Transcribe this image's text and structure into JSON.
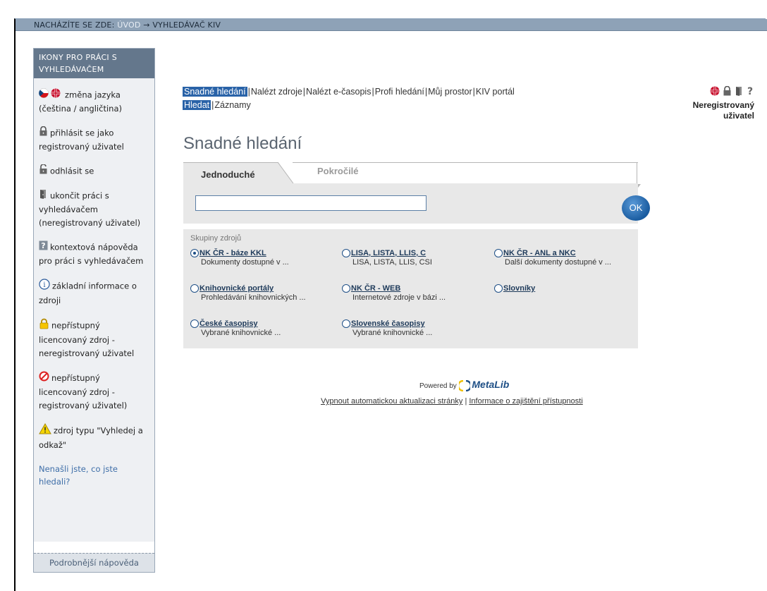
{
  "breadcrumb": {
    "prefix": "NACHÁZÍTE SE ZDE:",
    "home": "ÚVOD",
    "arrow": "→",
    "current": "VYHLEDÁVAČ KIV"
  },
  "sidebar": {
    "title": "IKONY PRO PRÁCI S VYHLEDÁVAČEM",
    "items": [
      {
        "icon": "language-flags-icon",
        "text": "změna jazyka (čeština / angličtina)"
      },
      {
        "icon": "lock-login-icon",
        "text": "přihlásit se jako registrovaný uživatel"
      },
      {
        "icon": "unlock-logout-icon",
        "text": "odhlásit se"
      },
      {
        "icon": "exit-door-icon",
        "text": "ukončit práci s vyhledávačem (neregistrovaný uživatel)"
      },
      {
        "icon": "help-question-icon",
        "text": "kontextová nápověda pro práci s vyhledávačem"
      },
      {
        "icon": "info-icon",
        "text": "základní informace o zdroji"
      },
      {
        "icon": "locked-yellow-icon",
        "text": "nepřístupný licencovaný zdroj - neregistrovaný uživatel"
      },
      {
        "icon": "forbidden-icon",
        "text": "nepřístupný licencovaný zdroj - registrovaný uživatel)"
      },
      {
        "icon": "warning-icon",
        "text": "zdroj typu \"Vyhledej a odkaž\""
      }
    ],
    "not_found": "Nenašli jste, co jste hledali?",
    "more_help": "Podrobnější nápověda"
  },
  "nav": {
    "main": [
      "Snadné hledání",
      "Nalézt zdroje",
      "Nalézt e-časopis",
      "Profi hledání",
      "Můj prostor",
      "KIV portál"
    ],
    "sub": [
      "Hledat",
      "Záznamy"
    ],
    "separator": "|"
  },
  "user": {
    "status_line1": "Neregistrovaný",
    "status_line2": "uživatel"
  },
  "page": {
    "title": "Snadné hledání"
  },
  "tabs": {
    "simple": "Jednoduché",
    "advanced": "Pokročilé"
  },
  "search": {
    "value": "",
    "ok_label": "OK"
  },
  "groups": {
    "label": "Skupiny zdrojů",
    "options": [
      {
        "name": "NK ČR - báze KKL",
        "desc": "Dokumenty dostupné v ...",
        "selected": true
      },
      {
        "name": "LISA, LISTA, LLIS, C",
        "desc": "LISA, LISTA, LLIS, CSI",
        "selected": false
      },
      {
        "name": "NK ČR - ANL a NKC",
        "desc": "Další dokumenty dostupné v ...",
        "selected": false
      },
      {
        "name": "Knihovnické portály",
        "desc": "Prohledávání knihovnických ...",
        "selected": false
      },
      {
        "name": "NK ČR - WEB",
        "desc": "Internetové zdroje v bázi ...",
        "selected": false
      },
      {
        "name": "Slovníky",
        "desc": "",
        "selected": false
      },
      {
        "name": "České časopisy",
        "desc": "Vybrané knihovnické ...",
        "selected": false
      },
      {
        "name": "Slovenské časopisy",
        "desc": "Vybrané knihovnické ...",
        "selected": false
      }
    ]
  },
  "footer": {
    "powered_by": "Powered by",
    "brand": "MetaLib",
    "link1": "Vypnout automatickou aktualizaci stránky",
    "link2": "Informace o zajištění přístupnosti",
    "separator": "|"
  },
  "colors": {
    "accent": "#2a63a8",
    "breadcrumb_bg": "#8ea2b7",
    "sidebar_head": "#64778c",
    "panel_bg": "#e8e8e8"
  }
}
